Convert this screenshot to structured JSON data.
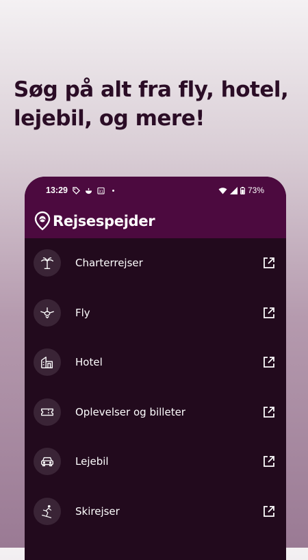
{
  "headline": "Søg på alt fra fly, hotel, lejebil, og mere!",
  "status_bar": {
    "time": "13:29",
    "battery": "73%",
    "notification_icons": [
      "tag-icon",
      "bowl-icon",
      "calendar-31-icon",
      "dot-icon"
    ]
  },
  "app": {
    "brand": "Rejsespejder"
  },
  "menu": [
    {
      "label": "Charterrejser",
      "icon": "palm-tree-icon"
    },
    {
      "label": "Fly",
      "icon": "airplane-icon"
    },
    {
      "label": "Hotel",
      "icon": "hotel-icon"
    },
    {
      "label": "Oplevelser og billeter",
      "icon": "ticket-icon"
    },
    {
      "label": "Lejebil",
      "icon": "car-icon"
    },
    {
      "label": "Skirejser",
      "icon": "skier-icon"
    }
  ],
  "colors": {
    "brand_purple": "#4c0a3f",
    "list_background": "#220a1d",
    "icon_circle": "#3a2436",
    "headline_text": "#2b0d26"
  }
}
